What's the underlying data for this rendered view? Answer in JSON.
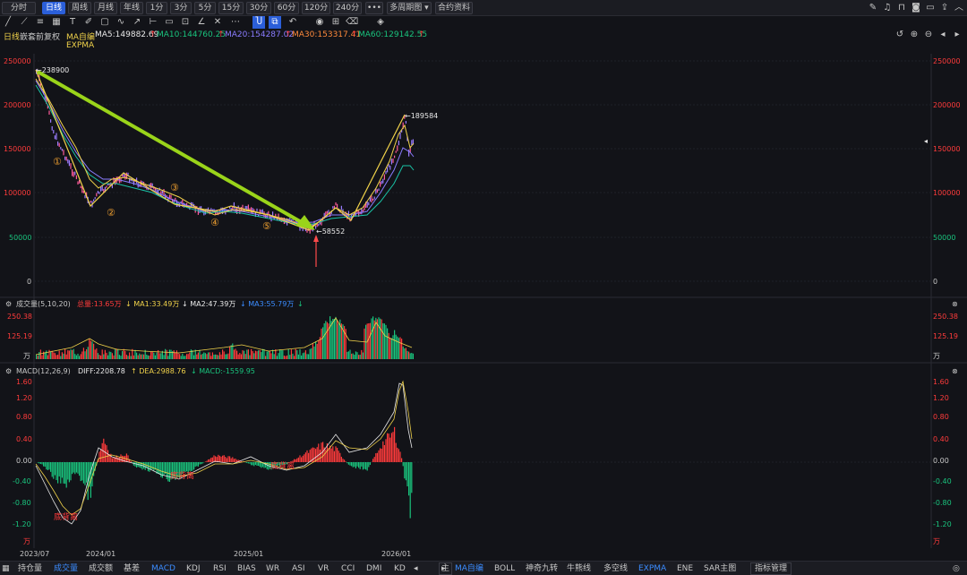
{
  "toolbar": {
    "periods": [
      "分时",
      "日线",
      "周线",
      "月线",
      "年线",
      "1分",
      "3分",
      "5分",
      "15分",
      "30分",
      "60分",
      "120分",
      "240分"
    ],
    "active_period": "日线",
    "more": "•••",
    "multi_period": "多周期图",
    "contract_info": "合约资料"
  },
  "chart_header": {
    "period": "日线",
    "adjust": "嵌套前复权",
    "ma_name": "MA自编",
    "ma5": "MA5:149882.69",
    "ma10": "MA10:144760.25",
    "ma20": "MA20:154287.02",
    "ma30": "MA30:153317.41",
    "ma60": "MA60:129142.55",
    "expma": "EXPMA"
  },
  "price_axis": [
    "250000",
    "200000",
    "150000",
    "100000",
    "50000",
    "0"
  ],
  "annotations": {
    "high_start": "238900",
    "low_point": "58552",
    "high_end": "189584",
    "waves": [
      "①",
      "②",
      "③",
      "④",
      "⑤"
    ]
  },
  "volume_panel": {
    "title": "成交量(5,10,20)",
    "total": "总量:13.65万",
    "ma1": "MA1:33.49万",
    "ma2": "MA2:47.39万",
    "ma3": "MA3:55.79万",
    "axis": [
      "250.38",
      "125.19",
      "万"
    ]
  },
  "macd_panel": {
    "title": "MACD(12,26,9)",
    "diff": "DIFF:2208.78",
    "dea": "DEA:2988.76",
    "macd": "MACD:-1559.95",
    "axis": [
      "1.60",
      "1.20",
      "0.80",
      "0.40",
      "0.00",
      "-0.40",
      "-0.80",
      "-1.20",
      "万"
    ],
    "labels": [
      "底背离",
      "底背离",
      "底背离"
    ]
  },
  "date_axis": [
    "2023/07",
    "2024/01",
    "2025/01",
    "2026/01"
  ],
  "bottom_tabs": {
    "left": [
      "持仓量",
      "成交量",
      "成交额",
      "基差",
      "MACD",
      "KDJ",
      "RSI",
      "BIAS",
      "WR",
      "ASI",
      "VR",
      "CCI",
      "DMI",
      "KD"
    ],
    "right_main": "主",
    "right": [
      "MA自编",
      "BOLL",
      "神奇九转",
      "牛熊线",
      "多空线",
      "EXPMA",
      "ENE",
      "SAR主图"
    ],
    "manage": "指标管理"
  },
  "colors": {
    "up": "#ff3b3b",
    "down": "#19c37d",
    "yellow": "#f0d24a",
    "blue": "#3b8cff",
    "bg": "#121318"
  }
}
